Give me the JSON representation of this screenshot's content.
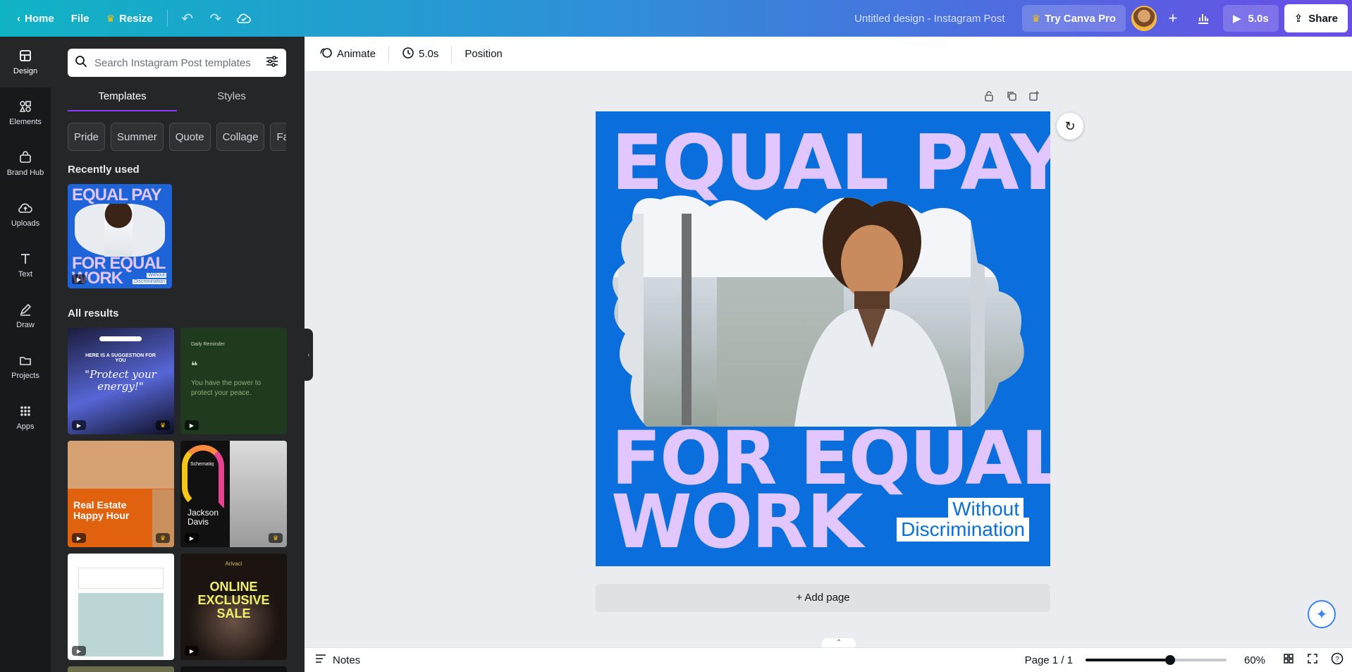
{
  "topbar": {
    "home": "Home",
    "file": "File",
    "resize": "Resize",
    "doc_title": "Untitled design - Instagram Post",
    "try_pro": "Try Canva Pro",
    "duration": "5.0s",
    "share": "Share",
    "icons": [
      "chevron-left-icon",
      "crown-icon",
      "undo-icon",
      "redo-icon",
      "cloud-save-icon",
      "plus-icon",
      "analytics-icon",
      "play-icon",
      "share-icon"
    ]
  },
  "rail": {
    "items": [
      {
        "label": "Design",
        "icon": "design-icon"
      },
      {
        "label": "Elements",
        "icon": "elements-icon"
      },
      {
        "label": "Brand Hub",
        "icon": "brand-hub-icon"
      },
      {
        "label": "Uploads",
        "icon": "uploads-icon"
      },
      {
        "label": "Text",
        "icon": "text-icon"
      },
      {
        "label": "Draw",
        "icon": "draw-icon"
      },
      {
        "label": "Projects",
        "icon": "projects-icon"
      },
      {
        "label": "Apps",
        "icon": "apps-icon"
      }
    ]
  },
  "panel": {
    "search_placeholder": "Search Instagram Post templates",
    "tabs": [
      "Templates",
      "Styles"
    ],
    "chips": [
      "Pride",
      "Summer",
      "Quote",
      "Collage",
      "Fa"
    ],
    "recently_used": "Recently used",
    "all_results": "All results",
    "recent_thumb": {
      "line1": "EQUAL PAY",
      "line2": "FOR EQUAL",
      "line3": "WORK",
      "sub1": "Without",
      "sub2": "Discrimination"
    },
    "results": [
      {
        "text1": "HERE IS A SUGGESTION FOR YOU",
        "text2": "\"Protect your energy!\""
      },
      {
        "text1": "Daily Reminder",
        "text2": "You have the power to protect your peace."
      },
      {
        "text1": "Real Estate Happy Hour",
        "text2": ""
      },
      {
        "text1": "Jackson Davis",
        "text2": "Schematiq"
      },
      {
        "text1": "",
        "text2": ""
      },
      {
        "text1": "ONLINE EXCLUSIVE SALE",
        "text2": "Arivaci"
      }
    ]
  },
  "context_toolbar": {
    "animate": "Animate",
    "duration": "5.0s",
    "position": "Position"
  },
  "design": {
    "line1": "EQUAL PAY",
    "line2": "FOR EQUAL",
    "line3": "WORK",
    "sub1": "Without",
    "sub2": "Discrimination",
    "bg_color": "#0a6fdc",
    "text_color": "#e2c6ff"
  },
  "canvas": {
    "add_page": "+ Add page"
  },
  "bottombar": {
    "notes": "Notes",
    "page": "Page 1 / 1",
    "zoom": "60%",
    "zoom_level": 0.6
  }
}
